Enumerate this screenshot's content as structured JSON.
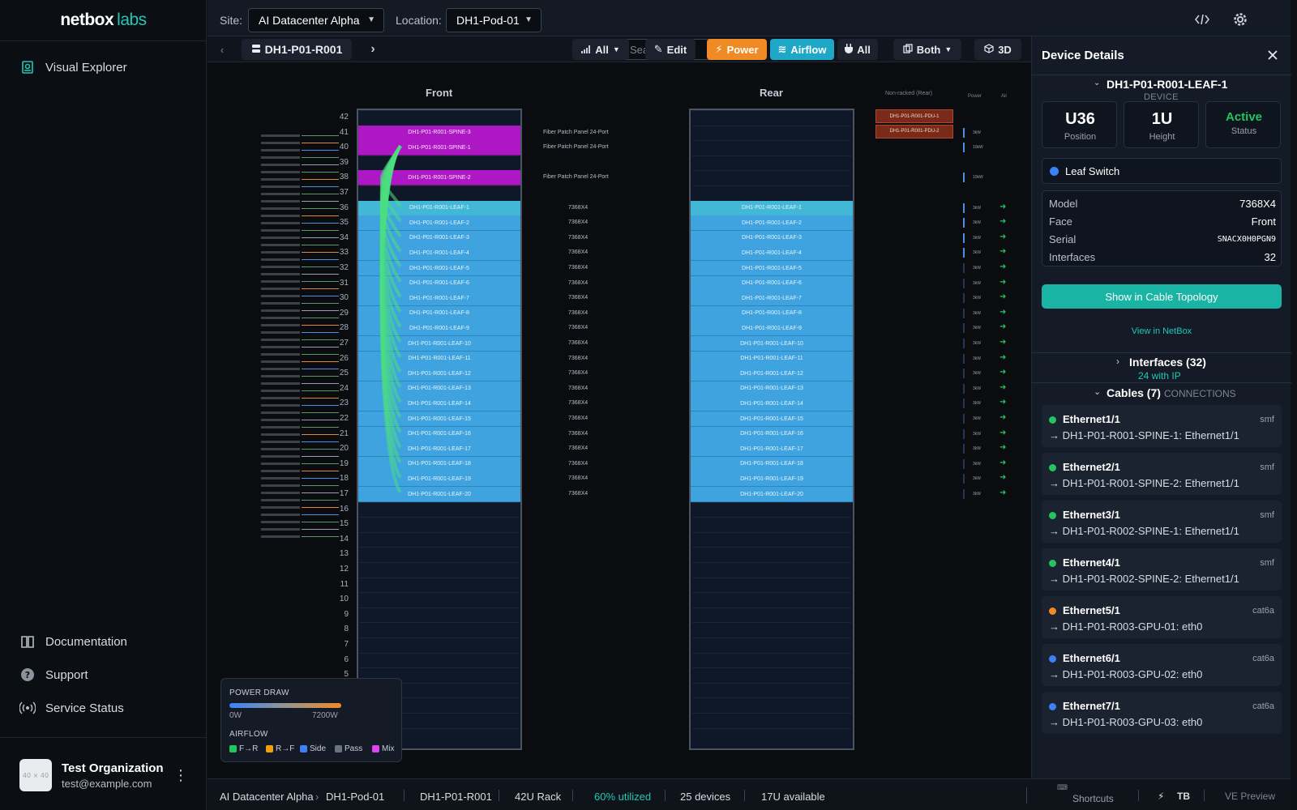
{
  "brand": {
    "part1": "netbox",
    "part2": "labs"
  },
  "sidebar": {
    "visual_explorer": "Visual Explorer",
    "documentation": "Documentation",
    "support": "Support",
    "service_status": "Service Status"
  },
  "org": {
    "avatar": "40 × 40",
    "name": "Test Organization",
    "email": "test@example.com"
  },
  "topbar": {
    "site_label": "Site:",
    "site_value": "AI Datacenter Alpha",
    "location_label": "Location:",
    "location_value": "DH1-Pod-01"
  },
  "toolbar": {
    "rack_name": "DH1-P01-R001",
    "search_placeholder": "Search...",
    "filter": "All",
    "edit": "Edit",
    "power": "Power",
    "airflow": "Airflow",
    "all_plug": "All",
    "both": "Both",
    "three_d": "3D"
  },
  "rack": {
    "front_label": "Front",
    "rear_label": "Rear",
    "nonracked_label": "Non-racked (Rear)",
    "power_col": "Power",
    "air_col": "Air",
    "units": [
      42,
      41,
      40,
      39,
      38,
      37,
      36,
      35,
      34,
      33,
      32,
      31,
      30,
      29,
      28,
      27,
      26,
      25,
      24,
      23,
      22,
      21,
      20,
      19,
      18,
      17,
      16,
      15,
      14,
      13,
      12,
      11,
      10,
      9,
      8,
      7,
      6,
      5
    ],
    "spines": [
      {
        "name": "DH1-P01-R001-SPINE-3",
        "u": 41,
        "model": "Fiber Patch Panel 24-Port"
      },
      {
        "name": "DH1-P01-R001-SPINE-1",
        "u": 40,
        "model": "Fiber Patch Panel 24-Port"
      },
      {
        "name": "DH1-P01-R001-SPINE-2",
        "u": 38,
        "model": "Fiber Patch Panel 24-Port"
      }
    ],
    "leaf_model": "7368X4",
    "leaves": [
      "DH1-P01-R001-LEAF-1",
      "DH1-P01-R001-LEAF-2",
      "DH1-P01-R001-LEAF-3",
      "DH1-P01-R001-LEAF-4",
      "DH1-P01-R001-LEAF-5",
      "DH1-P01-R001-LEAF-6",
      "DH1-P01-R001-LEAF-7",
      "DH1-P01-R001-LEAF-8",
      "DH1-P01-R001-LEAF-9",
      "DH1-P01-R001-LEAF-10",
      "DH1-P01-R001-LEAF-11",
      "DH1-P01-R001-LEAF-12",
      "DH1-P01-R001-LEAF-13",
      "DH1-P01-R001-LEAF-14",
      "DH1-P01-R001-LEAF-15",
      "DH1-P01-R001-LEAF-16",
      "DH1-P01-R001-LEAF-17",
      "DH1-P01-R001-LEAF-18",
      "DH1-P01-R001-LEAF-19",
      "DH1-P01-R001-LEAF-20"
    ],
    "pdus": [
      "DH1-P01-R001-PDU-1",
      "DH1-P01-R001-PDU-2"
    ],
    "power_marks": [
      "3kW",
      "10kW",
      "10kW",
      "3kW",
      "3kW",
      "3kW",
      "3kW",
      "3kW",
      "3kW",
      "3kW",
      "3kW",
      "3kW",
      "3kW",
      "3kW",
      "3kW",
      "3kW",
      "3kW",
      "3kW",
      "3kW",
      "3kW",
      "3kW",
      "3kW",
      "3kW"
    ]
  },
  "legend": {
    "power_title": "POWER DRAW",
    "min": "0W",
    "max": "7200W",
    "airflow_title": "AIRFLOW",
    "items": [
      {
        "label": "F→R",
        "color": "#22c55e"
      },
      {
        "label": "R→F",
        "color": "#f59e0b"
      },
      {
        "label": "Side",
        "color": "#3b82f6"
      },
      {
        "label": "Pass",
        "color": "#6b7280"
      },
      {
        "label": "Mix",
        "color": "#d946ef"
      }
    ]
  },
  "statusbar": {
    "site": "AI Datacenter Alpha",
    "location": "DH1-Pod-01",
    "rack": "DH1-P01-R001",
    "rack_size": "42U Rack",
    "utilized": "60% utilized",
    "devices": "25 devices",
    "available": "17U available",
    "shortcuts": "Shortcuts",
    "tb": "TB",
    "preview": "VE Preview"
  },
  "panel": {
    "title": "Device Details",
    "device_name": "DH1-P01-R001-LEAF-1",
    "device_sub": "DEVICE",
    "position_value": "U36",
    "position_label": "Position",
    "height_value": "1U",
    "height_label": "Height",
    "status_value": "Active",
    "status_label": "Status",
    "role": "Leaf Switch",
    "model_label": "Model",
    "model_value": "7368X4",
    "face_label": "Face",
    "face_value": "Front",
    "serial_label": "Serial",
    "serial_value": "SNACX0H0PGN9",
    "interfaces_label": "Interfaces",
    "interfaces_value": "32",
    "topology_button": "Show in Cable Topology",
    "netbox_link": "View in NetBox",
    "interfaces_section": "Interfaces (32)",
    "interfaces_sub": "24 with IP",
    "cables_section": "Cables (7)",
    "cables_sub": "CONNECTIONS",
    "cables": [
      {
        "name": "Ethernet1/1",
        "type": "smf",
        "dest": "→ DH1-P01-R001-SPINE-1: Ethernet1/1",
        "color": "#22c55e"
      },
      {
        "name": "Ethernet2/1",
        "type": "smf",
        "dest": "→ DH1-P01-R001-SPINE-2: Ethernet1/1",
        "color": "#22c55e"
      },
      {
        "name": "Ethernet3/1",
        "type": "smf",
        "dest": "→ DH1-P01-R002-SPINE-1: Ethernet1/1",
        "color": "#22c55e"
      },
      {
        "name": "Ethernet4/1",
        "type": "smf",
        "dest": "→ DH1-P01-R002-SPINE-2: Ethernet1/1",
        "color": "#22c55e"
      },
      {
        "name": "Ethernet5/1",
        "type": "cat6a",
        "dest": "→ DH1-P01-R003-GPU-01: eth0",
        "color": "#f08a24"
      },
      {
        "name": "Ethernet6/1",
        "type": "cat6a",
        "dest": "→ DH1-P01-R003-GPU-02: eth0",
        "color": "#3b82f6"
      },
      {
        "name": "Ethernet7/1",
        "type": "cat6a",
        "dest": "→ DH1-P01-R003-GPU-03: eth0",
        "color": "#3b82f6"
      }
    ]
  }
}
